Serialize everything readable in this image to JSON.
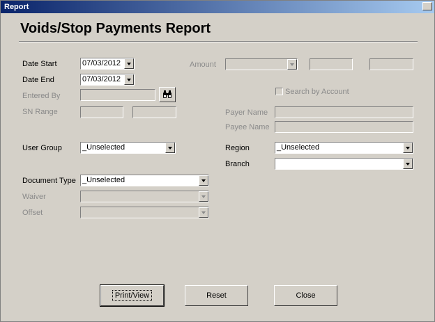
{
  "window": {
    "title": "Report"
  },
  "heading": "Voids/Stop Payments Report",
  "fields": {
    "date_start": {
      "label": "Date Start",
      "value": "07/03/2012"
    },
    "date_end": {
      "label": "Date End",
      "value": "07/03/2012"
    },
    "entered_by": {
      "label": "Entered By",
      "value": ""
    },
    "sn_range": {
      "label": "SN Range",
      "from": "",
      "to": ""
    },
    "user_group": {
      "label": "User Group",
      "value": "_Unselected"
    },
    "document_type": {
      "label": "Document Type",
      "value": "_Unselected"
    },
    "waiver": {
      "label": "Waiver",
      "value": ""
    },
    "offset": {
      "label": "Offset",
      "value": ""
    },
    "amount": {
      "label": "Amount",
      "value": ""
    },
    "search_by_account": {
      "label": "Search by Account",
      "checked": false
    },
    "payer_name": {
      "label": "Payer Name",
      "value": ""
    },
    "payee_name": {
      "label": "Payee Name",
      "value": ""
    },
    "region": {
      "label": "Region",
      "value": "_Unselected"
    },
    "branch": {
      "label": "Branch",
      "value": ""
    }
  },
  "buttons": {
    "print_view": "Print/View",
    "reset": "Reset",
    "close": "Close"
  },
  "icons": {
    "lookup": "binoculars-icon",
    "window_close": "close-icon"
  }
}
